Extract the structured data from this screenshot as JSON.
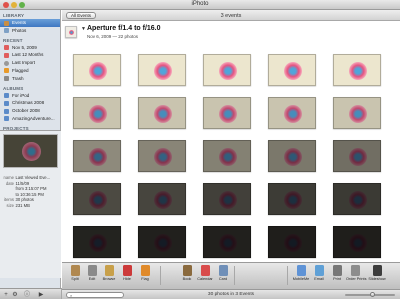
{
  "window": {
    "title": "iPhoto"
  },
  "sidebar": {
    "library_header": "LIBRARY",
    "library_items": [
      {
        "label": "Events",
        "icon": "events-icon",
        "selected": true
      },
      {
        "label": "Photos",
        "icon": "photos-icon"
      }
    ],
    "recent_header": "RECENT",
    "recent_items": [
      {
        "label": "Nov 5, 2009",
        "icon": "calendar-icon"
      },
      {
        "label": "Last 12 Months",
        "icon": "calendar-icon"
      },
      {
        "label": "Last Import",
        "icon": "clock-icon"
      },
      {
        "label": "Flagged",
        "icon": "flag-icon"
      },
      {
        "label": "Trash",
        "icon": "trash-icon"
      }
    ],
    "albums_header": "ALBUMS",
    "album_items": [
      {
        "label": "For iPod",
        "icon": "album-icon"
      },
      {
        "label": "Christmas 2008",
        "icon": "album-icon"
      },
      {
        "label": "October 2008",
        "icon": "album-icon"
      },
      {
        "label": "AmazingAdventure...",
        "icon": "album-icon"
      }
    ],
    "projects_header": "PROJECTS",
    "project_items": [
      {
        "label": "Month Ten Update",
        "icon": "project-icon"
      },
      {
        "label": "Urban Babies",
        "icon": "project-icon"
      },
      {
        "label": "Summer 2008 book",
        "icon": "book-icon"
      }
    ]
  },
  "info": {
    "rows": [
      {
        "key": "name",
        "value": "Last Viewed Eve..."
      },
      {
        "key": "date",
        "value": "11/5/09"
      },
      {
        "key": "",
        "value": "from 3:15:07 PM"
      },
      {
        "key": "",
        "value": "to 10:36:15 PM"
      },
      {
        "key": "items",
        "value": "30 photos"
      },
      {
        "key": "size",
        "value": "231 MB"
      }
    ]
  },
  "header": {
    "all_events_label": "All Events",
    "events_count": "3 events"
  },
  "event": {
    "disclosure": "▼",
    "title": "Aperture f/1.4 to f/16.0",
    "subtitle": "Nov 6, 2009 — 22 photos"
  },
  "photos": {
    "brightness_levels": [
      [
        1.0,
        1.0,
        1.0,
        1.0,
        1.0
      ],
      [
        0.85,
        0.85,
        0.85,
        0.85,
        0.85
      ],
      [
        0.6,
        0.58,
        0.56,
        0.52,
        0.48
      ],
      [
        0.32,
        0.3,
        0.28,
        0.26,
        0.25
      ],
      [
        0.15,
        0.14,
        0.14,
        0.13,
        0.13
      ],
      [
        0.08,
        0.07
      ]
    ]
  },
  "toolbar": {
    "items": [
      {
        "label": "Split",
        "icon": "split-icon"
      },
      {
        "label": "Edit",
        "icon": "edit-icon"
      },
      {
        "label": "Browse",
        "icon": "browse-icon"
      },
      {
        "label": "Hide",
        "icon": "hide-icon"
      },
      {
        "label": "Flag",
        "icon": "flag-icon"
      },
      {
        "label": "Book",
        "icon": "book-icon"
      },
      {
        "label": "Calendar",
        "icon": "calendar-icon"
      },
      {
        "label": "Card",
        "icon": "card-icon"
      },
      {
        "label": "MobileMe",
        "icon": "mobileme-icon"
      },
      {
        "label": "Email",
        "icon": "email-icon"
      },
      {
        "label": "Print",
        "icon": "print-icon"
      },
      {
        "label": "Order Prints",
        "icon": "order-prints-icon"
      },
      {
        "label": "Slideshow",
        "icon": "slideshow-icon"
      }
    ]
  },
  "status": {
    "search_icon": "search-icon",
    "search_placeholder": "",
    "text": "30 photos in 3 Events",
    "zoom_level": 0.55
  },
  "colors": {
    "selection": "#4a83c9",
    "sidebar_bg": "#dde3ea",
    "accent_red": "#e0507a"
  }
}
